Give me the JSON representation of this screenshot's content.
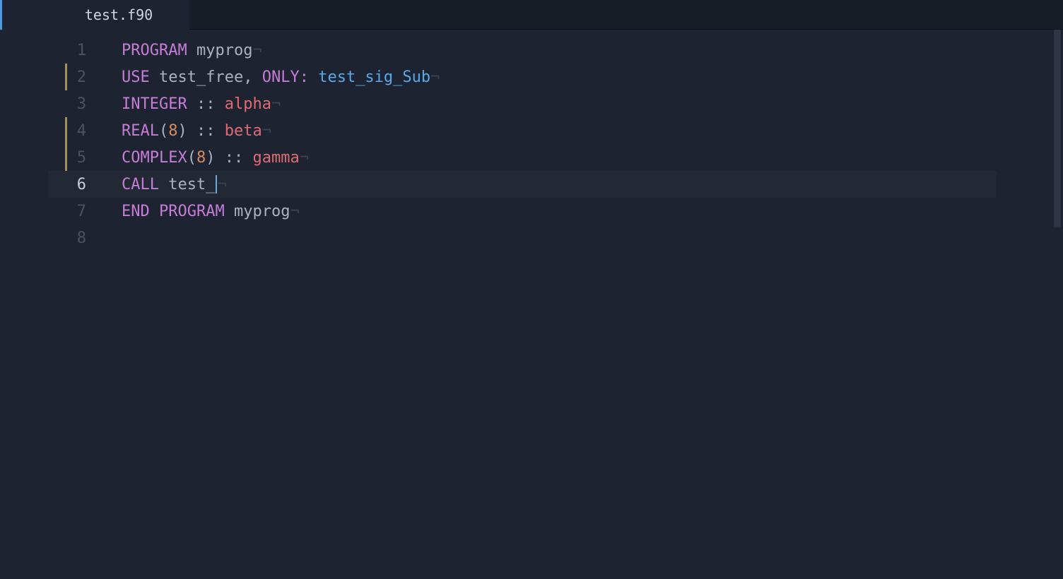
{
  "tab": {
    "filename": "test.f90"
  },
  "editor": {
    "active_line": 6,
    "line_numbers": [
      "1",
      "2",
      "3",
      "4",
      "5",
      "6",
      "7",
      "8"
    ],
    "whitespace_eol_marker": "¬",
    "lines": {
      "1": {
        "keyword": "PROGRAM",
        "space": " ",
        "name": "myprog",
        "modified": false
      },
      "2": {
        "keyword": "USE",
        "space": " ",
        "module": "test_free",
        "comma": ",",
        "space2": " ",
        "only_kw": "ONLY",
        "colon": ":",
        "space3": " ",
        "imported": "test_sig_Sub",
        "modified": true
      },
      "3": {
        "type_kw": "INTEGER",
        "space": " ",
        "sep": "::",
        "space2": " ",
        "var": "alpha",
        "modified": false
      },
      "4": {
        "type_kw": "REAL",
        "lparen": "(",
        "kind": "8",
        "rparen": ")",
        "space": " ",
        "sep": "::",
        "space2": " ",
        "var": "beta",
        "modified": true
      },
      "5": {
        "type_kw": "COMPLEX",
        "lparen": "(",
        "kind": "8",
        "rparen": ")",
        "space": " ",
        "sep": "::",
        "space2": " ",
        "var": "gamma",
        "modified": true
      },
      "6": {
        "keyword": "CALL",
        "space": " ",
        "call_name": "test_",
        "modified": false
      },
      "7": {
        "keyword": "END",
        "space": " ",
        "keyword2": "PROGRAM",
        "space2": " ",
        "name": "myprog",
        "modified": false
      },
      "8": {
        "empty": "",
        "modified": false
      }
    }
  }
}
